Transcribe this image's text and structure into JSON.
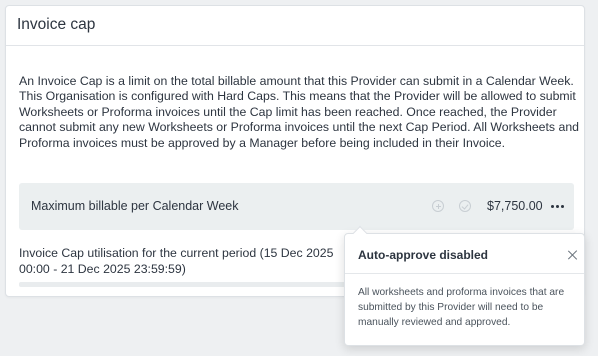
{
  "card": {
    "title": "Invoice cap",
    "description": "An Invoice Cap is a limit on the total billable amount that this Provider can submit in a Calendar Week. This Organisation is configured with Hard Caps. This means that the Provider will be allowed to submit Worksheets or Proforma invoices until the Cap limit has been reached. Once reached, the Provider cannot submit any new Worksheets or Proforma invoices until the next Cap Period. All Worksheets and Proforma invoices must be approved by a Manager before being included in their Invoice."
  },
  "cap_row": {
    "label": "Maximum billable per Calendar Week",
    "amount": "$7,750.00",
    "icons": [
      "plus-circle-icon",
      "check-circle-icon",
      "more-options-icon"
    ]
  },
  "utilisation": {
    "text": "Invoice Cap utilisation for the current period (15 Dec 2025 00:00 - 21 Dec 2025 23:59:59)"
  },
  "popover": {
    "title": "Auto-approve disabled",
    "body": "All worksheets and proforma invoices that are submitted by this Provider will need to be manually reviewed and approved."
  },
  "colors": {
    "page_background": "#eef0f2",
    "card_background": "#ffffff",
    "row_background": "#ebeff0",
    "text": "#2d3540"
  }
}
